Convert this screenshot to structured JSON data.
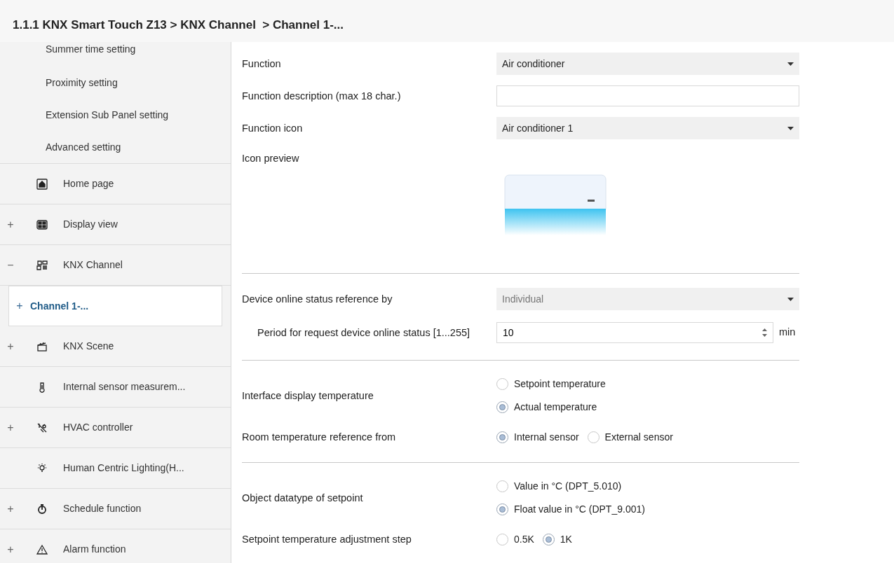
{
  "breadcrumb": "1.1.1 KNX Smart Touch Z13 > KNX Channel  > Channel 1-...",
  "sidebar": {
    "sub_items": [
      "Summer time setting",
      "Proximity setting",
      "Extension Sub Panel setting",
      "Advanced setting"
    ],
    "items": [
      {
        "label": "Home page",
        "selected": false
      },
      {
        "label": "Display view",
        "expander": "+",
        "selected": false
      },
      {
        "label": "KNX Channel",
        "expander": "−",
        "selected": false,
        "children": [
          {
            "label": "Channel 1-...",
            "expander": "+",
            "selected": true
          }
        ]
      },
      {
        "label": "KNX Scene",
        "expander": "+",
        "selected": false
      },
      {
        "label": "Internal sensor measurem...",
        "selected": false
      },
      {
        "label": "HVAC controller",
        "expander": "+",
        "selected": false
      },
      {
        "label": "Human Centric Lighting(H...",
        "selected": false
      },
      {
        "label": "Schedule function",
        "expander": "+",
        "selected": false
      },
      {
        "label": "Alarm function",
        "expander": "+",
        "selected": false
      }
    ]
  },
  "params": [
    {
      "kind": "dropdown",
      "label": "Function",
      "value": "Air conditioner",
      "disabled": false
    },
    {
      "kind": "text",
      "label": "Function description (max 18 char.)"
    },
    {
      "kind": "dropdown",
      "label": "Function icon",
      "value": "Air conditioner 1",
      "disabled": false
    },
    {
      "kind": "preview",
      "label": "Icon preview"
    },
    {
      "kind": "divider"
    },
    {
      "kind": "dropdown",
      "label": "Device online status reference by",
      "value": "Individual",
      "disabled": true
    },
    {
      "kind": "spin",
      "label": "Period for request device online status [1...255]",
      "value": "10",
      "unit": "min"
    },
    {
      "kind": "divider"
    },
    {
      "kind": "radio_column",
      "label": "Interface display temperature",
      "options": [
        {
          "label": "Setpoint temperature",
          "selected": false
        },
        {
          "label": "Actual temperature",
          "selected": true
        }
      ]
    },
    {
      "kind": "radio_row",
      "label": "Room temperature reference from",
      "options": [
        {
          "label": "Internal sensor",
          "selected": true
        },
        {
          "label": "External sensor",
          "selected": false
        }
      ]
    },
    {
      "kind": "divider"
    },
    {
      "kind": "radio_column",
      "label": "Object datatype of setpoint",
      "options": [
        {
          "label": "Value in °C (DPT_5.010)",
          "selected": false
        },
        {
          "label": "Float value in °C (DPT_9.001)",
          "selected": true
        }
      ]
    },
    {
      "kind": "radio_row",
      "label": "Setpoint temperature adjustment step",
      "options": [
        {
          "label": "0.5K",
          "selected": false
        },
        {
          "label": "1K",
          "selected": true
        }
      ]
    }
  ]
}
